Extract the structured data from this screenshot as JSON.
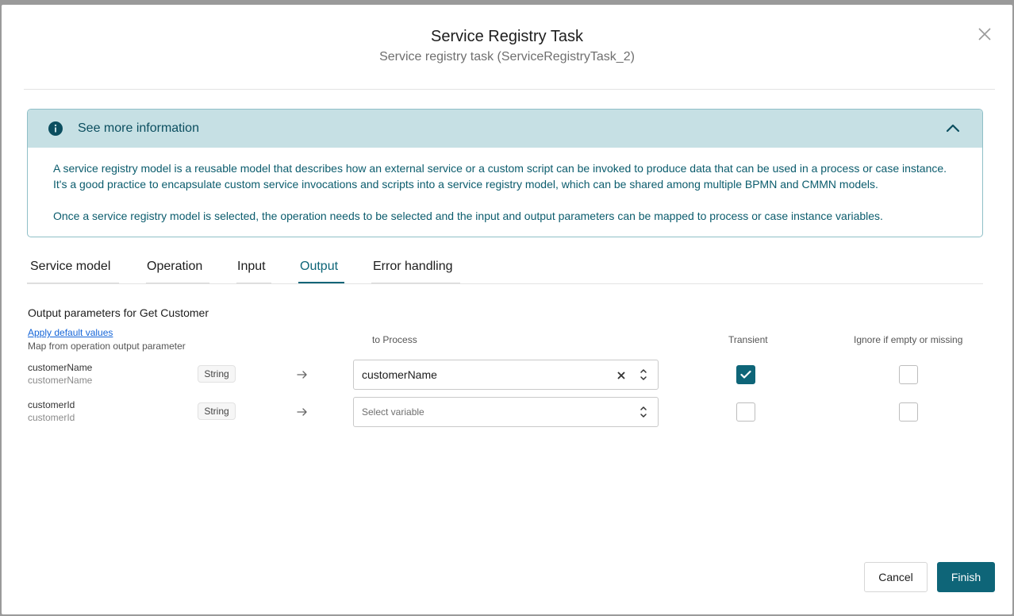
{
  "dialog": {
    "title": "Service Registry Task",
    "subtitle": "Service registry task (ServiceRegistryTask_2)"
  },
  "info_panel": {
    "title": "See more information",
    "paragraph1": "A service registry model is a reusable model that describes how an external service or a custom script can be invoked to produce data that can be used in a process or case instance. It's a good practice to encapsulate custom service invocations and scripts into a service registry model, which can be shared among multiple BPMN and CMMN models.",
    "paragraph2": "Once a service registry model is selected, the operation needs to be selected and the input and output parameters can be mapped to process or case instance variables.",
    "expanded": true
  },
  "tabs": [
    {
      "label": "Service model"
    },
    {
      "label": "Operation"
    },
    {
      "label": "Input"
    },
    {
      "label": "Output",
      "active": true
    },
    {
      "label": "Error handling"
    }
  ],
  "output": {
    "section_title": "Output parameters for Get Customer",
    "apply_default_link": "Apply default values",
    "map_from_label": "Map from operation output parameter",
    "to_process_label": "to Process",
    "transient_label": "Transient",
    "ignore_label": "Ignore if empty or missing",
    "rows": [
      {
        "name": "customerName",
        "id": "customerName",
        "type": "String",
        "variable": "customerName",
        "placeholder": "",
        "transient": true,
        "ignore": false
      },
      {
        "name": "customerId",
        "id": "customerId",
        "type": "String",
        "variable": "",
        "placeholder": "Select variable",
        "transient": false,
        "ignore": false
      }
    ]
  },
  "footer": {
    "cancel_label": "Cancel",
    "finish_label": "Finish"
  },
  "colors": {
    "accent": "#0e6578",
    "info_header_bg": "#c6e0e4",
    "info_text": "#0b5c6d",
    "link": "#1565d8"
  },
  "icons": {
    "close": "close-icon",
    "info": "info-icon",
    "collapse": "chevron-up-icon",
    "arrow": "arrow-right-icon",
    "clear": "clear-icon",
    "sort": "chevron-updown-icon",
    "check": "checkmark-icon"
  }
}
